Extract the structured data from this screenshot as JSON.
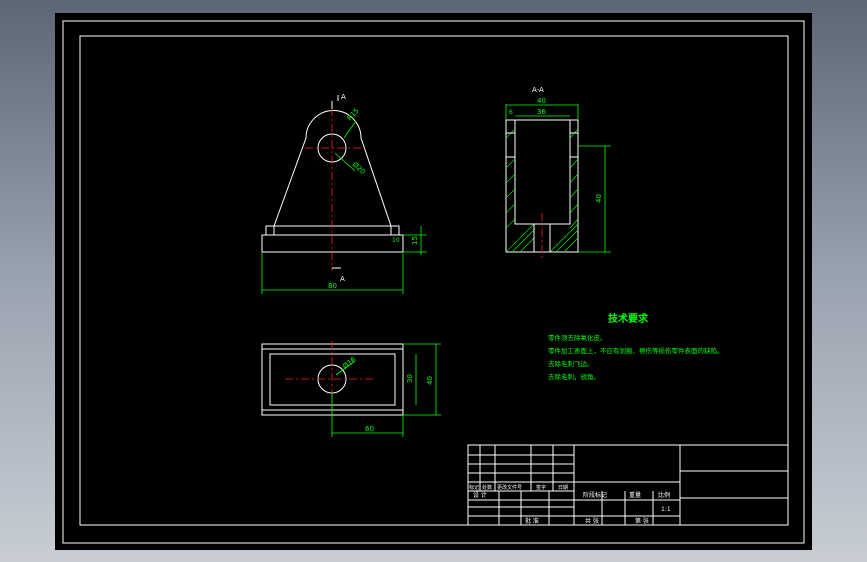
{
  "front_view": {
    "section_mark": "A",
    "section_mark_bottom": "A",
    "dim_radius": "R15",
    "dim_hole": "Ø20",
    "dim_width": "80",
    "dim_base_height": "15"
  },
  "section_view": {
    "title": "A-A",
    "dim_outer_width": "40",
    "dim_inner_width": "36",
    "dim_wall": "6",
    "dim_height": "40"
  },
  "top_view": {
    "dim_hole": "Ø16",
    "dim_inner": "30",
    "dim_depth": "40",
    "dim_length": "60"
  },
  "tech_notes": {
    "heading": "技术要求",
    "lines": [
      "零件须去除氧化皮。",
      "零件加工表面上，不应有划痕、擦伤等损伤零件表面的缺陷。",
      "去除毛刺飞边。",
      "去除毛刺，锐角。"
    ]
  },
  "title_block": {
    "rev_headers": [
      "标记",
      "处数",
      "更改文件号",
      "签字",
      "日期"
    ],
    "designer_label": "设 计",
    "stage_label": "阶段标记",
    "weight_label": "重量",
    "scale_label": "比例",
    "scale_value": "1:1",
    "approve_label": "批 准",
    "sheets_total": "共   张",
    "sheet_no": "第   张"
  }
}
